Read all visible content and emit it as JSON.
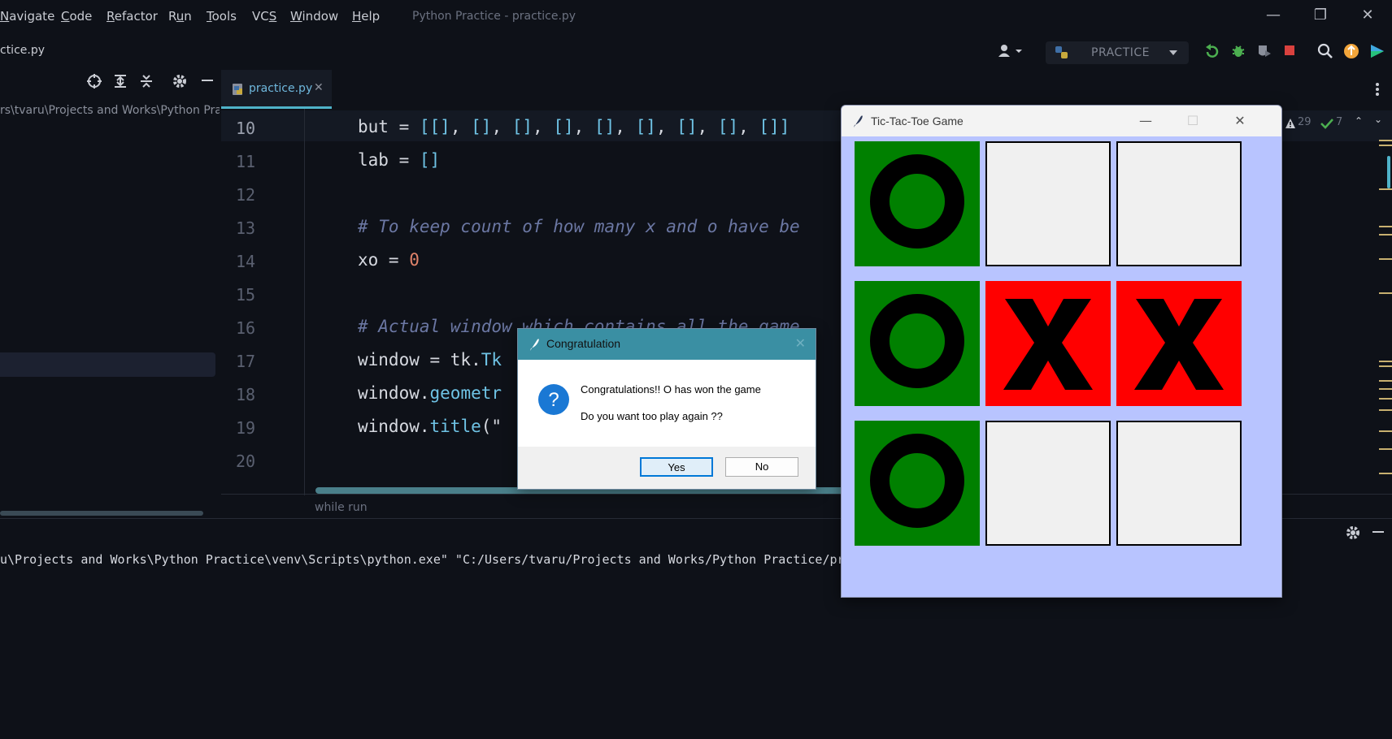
{
  "menu": {
    "items": [
      {
        "label": "Navigate",
        "mnemonic_index": 0
      },
      {
        "label": "Code",
        "mnemonic_index": 0
      },
      {
        "label": "Refactor",
        "mnemonic_index": 0
      },
      {
        "label": "Run",
        "mnemonic_index": 1
      },
      {
        "label": "Tools",
        "mnemonic_index": 0
      },
      {
        "label": "VCS",
        "mnemonic_index": 2
      },
      {
        "label": "Window",
        "mnemonic_index": 0
      },
      {
        "label": "Help",
        "mnemonic_index": 0
      }
    ],
    "window_title": "Python Practice - practice.py"
  },
  "toolbar": {
    "breadcrumb_file": "ctice.py",
    "run_config": "PRACTICE"
  },
  "project": {
    "path": "rs\\tvaru\\Projects and Works\\Python Practi"
  },
  "editor": {
    "tab_label": "practice.py",
    "inspections": {
      "warnings": "29",
      "checks": "7"
    },
    "lines": [
      {
        "num": "10",
        "code": "but = [[], [], [], [], [], [], [], [], []]"
      },
      {
        "num": "11",
        "code": "lab = []"
      },
      {
        "num": "12",
        "code": ""
      },
      {
        "num": "13",
        "code": "# To keep count of how many x and o have be"
      },
      {
        "num": "14",
        "code": "xo = 0"
      },
      {
        "num": "15",
        "code": ""
      },
      {
        "num": "16",
        "code": "# Actual window which contains all the game"
      },
      {
        "num": "17",
        "code": "window = tk.Tk"
      },
      {
        "num": "18",
        "code": "window.geometr"
      },
      {
        "num": "19",
        "code": "window.title(\""
      },
      {
        "num": "20",
        "code": ""
      }
    ],
    "status_breadcrumb": "while run"
  },
  "console": {
    "command": "u\\Projects and Works\\Python Practice\\venv\\Scripts\\python.exe\" \"C:/Users/tvaru/Projects and Works/Python Practice/pr"
  },
  "game_window": {
    "title": "Tic-Tac-Toe Game",
    "board": [
      "O",
      "",
      "",
      "O",
      "X",
      "X",
      "O",
      "",
      ""
    ],
    "colors": {
      "o_cell": "#008000",
      "x_cell": "#ff0000",
      "empty_cell": "#f0f0f0",
      "background": "#b8c4ff"
    }
  },
  "dialog": {
    "title": "Congratulation",
    "message_line1": "Congratulations!! O has won the game",
    "message_line2": "Do you want too play again ??",
    "yes_label": "Yes",
    "no_label": "No",
    "icon": "question-icon"
  }
}
